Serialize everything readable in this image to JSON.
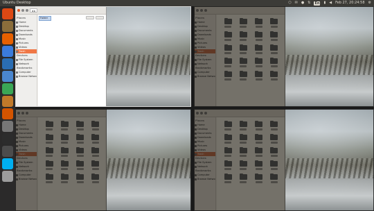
{
  "panel": {
    "title": "Ubuntu Desktop",
    "clock": "Feb 27, 20:24:58",
    "keyboard": "En",
    "indicators": [
      "dropbox-icon",
      "mail-icon",
      "chat-icon",
      "network-icon",
      "keyboard-icon",
      "battery-icon",
      "volume-icon",
      "session-gear-icon"
    ]
  },
  "launcher": {
    "items": [
      {
        "name": "dash-home-icon",
        "color": "#dd4814"
      },
      {
        "name": "files-icon",
        "color": "#8a6d3b"
      },
      {
        "name": "firefox-icon",
        "color": "#e66000"
      },
      {
        "name": "chromium-icon",
        "color": "#3b7bdb"
      },
      {
        "name": "thunderbird-icon",
        "color": "#2a6db3"
      },
      {
        "name": "libreoffice-writer-icon",
        "color": "#4a86cf"
      },
      {
        "name": "libreoffice-calc-icon",
        "color": "#3aa655"
      },
      {
        "name": "libreoffice-impress-icon",
        "color": "#c0792a"
      },
      {
        "name": "software-center-icon",
        "color": "#d35400"
      },
      {
        "name": "settings-icon",
        "color": "#777777"
      },
      {
        "name": "terminal-icon",
        "color": "#2c2c2c"
      },
      {
        "name": "workspace-switcher-icon",
        "color": "#4c4c4c"
      },
      {
        "name": "skype-icon",
        "color": "#00aff0"
      },
      {
        "name": "trash-icon",
        "color": "#9c9c9c"
      }
    ]
  },
  "file_manager": {
    "sidebar": [
      "Places",
      "Home",
      "Desktop",
      "Documents",
      "Downloads",
      "Music",
      "Pictures",
      "Videos",
      "Trash",
      "Devices",
      "File System",
      "Network",
      "Bookmarks",
      "Computer",
      "Browse Network"
    ],
    "selected_sidebar": "Trash",
    "selected_item": "Folder"
  },
  "workspaces": [
    {
      "label": "workspace-1",
      "active": true
    },
    {
      "label": "workspace-2",
      "active": false
    },
    {
      "label": "workspace-3",
      "active": false
    },
    {
      "label": "workspace-4",
      "active": false
    }
  ]
}
